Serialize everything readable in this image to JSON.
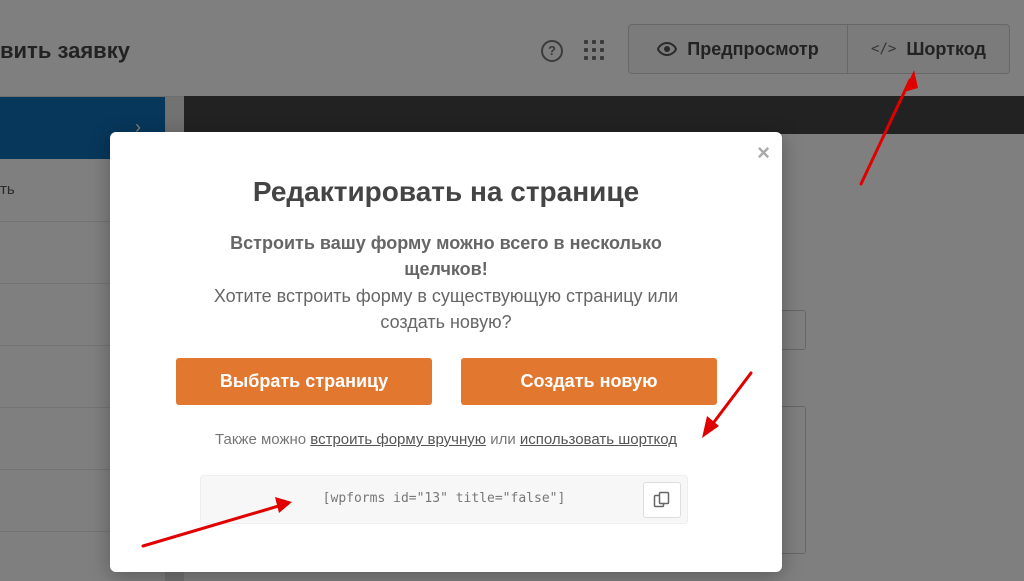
{
  "header": {
    "title": "вить заявку",
    "help_glyph": "?",
    "preview_label": "Предпросмотр",
    "shortcode_label": "Шорткод",
    "code_glyph": "</>"
  },
  "sidebar": {
    "active_chevron": "›",
    "items": [
      {
        "label": "ть"
      }
    ]
  },
  "modal": {
    "close_glyph": "×",
    "title": "Редактировать на странице",
    "subtitle": "Встроить вашу форму можно всего в несколько щелчков!",
    "description": "Хотите встроить форму в существующую страницу или создать новую?",
    "choose_page_label": "Выбрать страницу",
    "create_new_label": "Создать новую",
    "links": {
      "prefix": "Также можно",
      "embed_manually": "встроить форму вручную",
      "or": "или",
      "use_shortcode": "использовать шорткод"
    },
    "shortcode": "[wpforms id=\"13\" title=\"false\"]"
  },
  "colors": {
    "accent_orange": "#e27730",
    "sidebar_active": "#0e6fb6",
    "annotation_arrow": "#e00000"
  }
}
